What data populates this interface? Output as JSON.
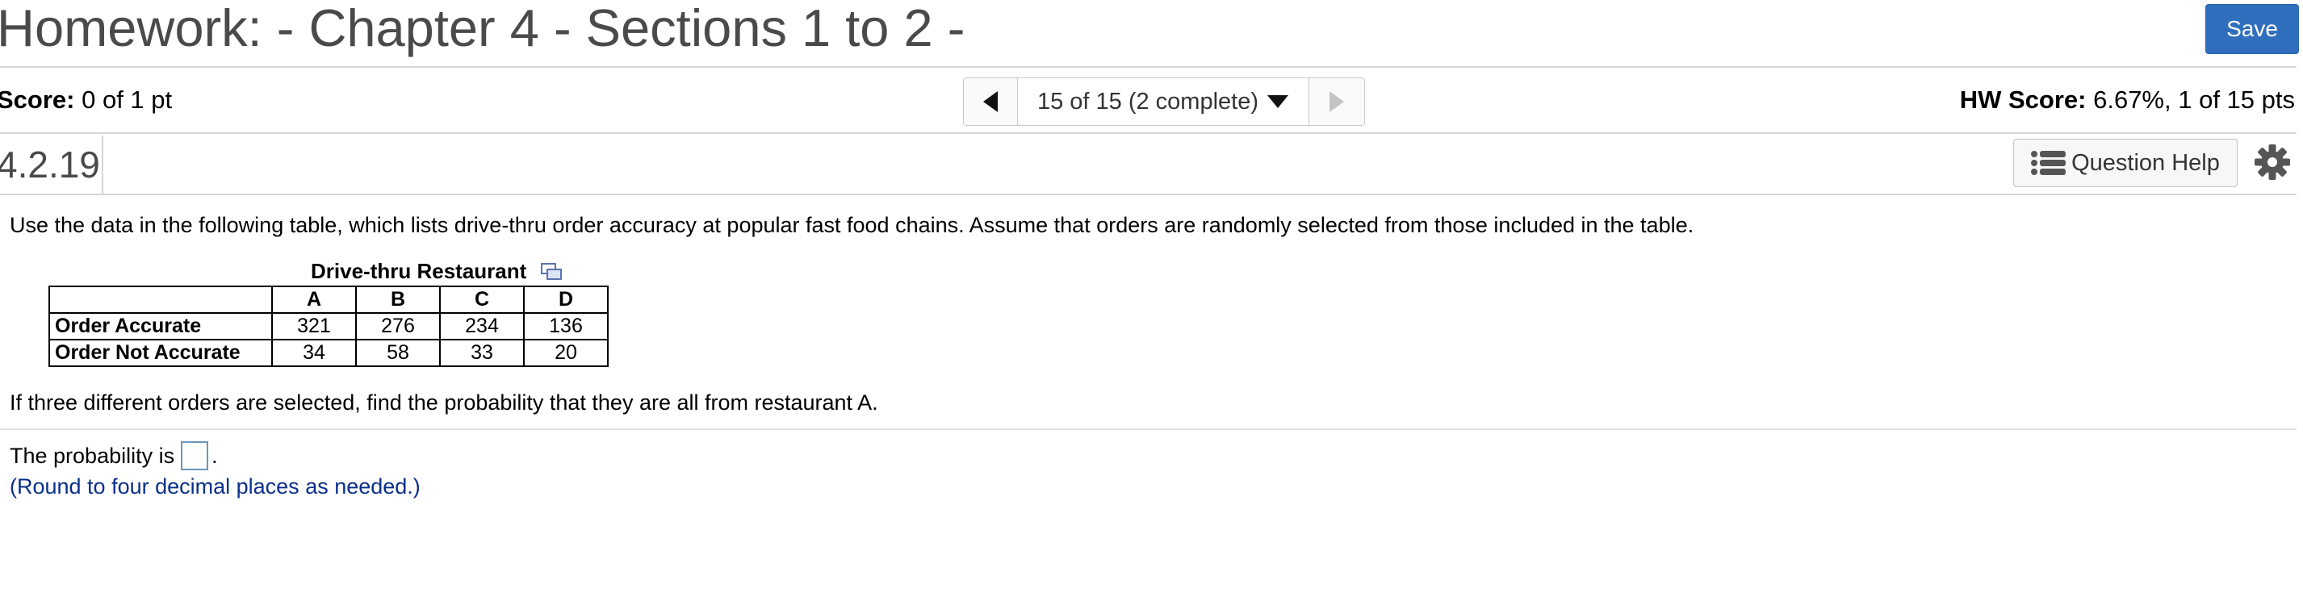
{
  "header": {
    "title": "Homework: - Chapter 4 - Sections 1 to 2 -",
    "save_label": "Save"
  },
  "score_bar": {
    "score_label": "Score:",
    "score_value": "0 of 1 pt",
    "nav_status": "15 of 15 (2 complete)",
    "hw_score_label": "HW Score:",
    "hw_score_value": "6.67%, 1 of 15 pts"
  },
  "question_bar": {
    "question_id": "4.2.19",
    "help_label": "Question Help"
  },
  "content": {
    "intro": "Use the data in the following table, which lists drive-thru order accuracy at popular fast food chains. Assume that orders are randomly selected from those included in the table.",
    "table": {
      "caption": "Drive-thru Restaurant",
      "columns": [
        "A",
        "B",
        "C",
        "D"
      ],
      "rows": [
        {
          "label": "Order Accurate",
          "values": [
            "321",
            "276",
            "234",
            "136"
          ]
        },
        {
          "label": "Order Not Accurate",
          "values": [
            "34",
            "58",
            "33",
            "20"
          ]
        }
      ]
    },
    "question": "If three different orders are selected, find the probability that they are all from restaurant A.",
    "answer_prefix": "The probability is",
    "answer_suffix": ".",
    "answer_value": "",
    "rounding_note": "(Round to four decimal places as needed.)"
  },
  "colors": {
    "save_button": "#2f6fbd",
    "note_text": "#0a2f8a",
    "title_text": "#4a4a4a"
  },
  "icons": [
    "prev-arrow-icon",
    "dropdown-caret-icon",
    "next-arrow-icon",
    "list-icon",
    "gear-icon",
    "popout-icon"
  ]
}
